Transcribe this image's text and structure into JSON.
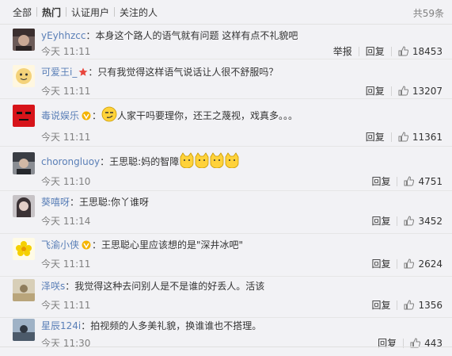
{
  "tabs": [
    "全部",
    "热门",
    "认证用户",
    "关注的人"
  ],
  "total": "共59条",
  "comments": [
    {
      "user": "yEyhhzcc",
      "text": "：本身这个路人的语气就有问题 这样有点不礼貌吧",
      "time": "今天 11:11",
      "report": "举报",
      "reply": "回复",
      "likes": "18453"
    },
    {
      "user": "可爱王i_",
      "text": "：只有我觉得这样语气说话让人很不舒服吗？",
      "time": "今天 11:11",
      "reply": "回复",
      "likes": "13207"
    },
    {
      "user": "毒说娱乐",
      "text": "人家干吗要理你，还王之蔑视，戏真多。。。",
      "time": "今天 11:11",
      "reply": "回复",
      "likes": "11361"
    },
    {
      "user": "chorongluoy",
      "text": "：王思聪:妈的智障",
      "time": "今天 11:10",
      "reply": "回复",
      "likes": "4751"
    },
    {
      "user": "葵嘻呀",
      "text": "：王思聪:你丫谁呀",
      "time": "今天 11:14",
      "reply": "回复",
      "likes": "3452"
    },
    {
      "user": "飞渝小侠",
      "text": "：王思聪心里应该想的是\"深井冰吧\"",
      "time": "今天 11:11",
      "reply": "回复",
      "likes": "2624"
    },
    {
      "user": "泽咲s",
      "text": "：我觉得这种去问别人是不是谁的好丢人。活该",
      "time": "今天 11:11",
      "reply": "回复",
      "likes": "1356"
    },
    {
      "user": "星辰124i",
      "text": "：拍视频的人多美礼貌，换谁谁也不搭理。",
      "time": "今天 11:30",
      "reply": "回复",
      "likes": "443"
    }
  ]
}
